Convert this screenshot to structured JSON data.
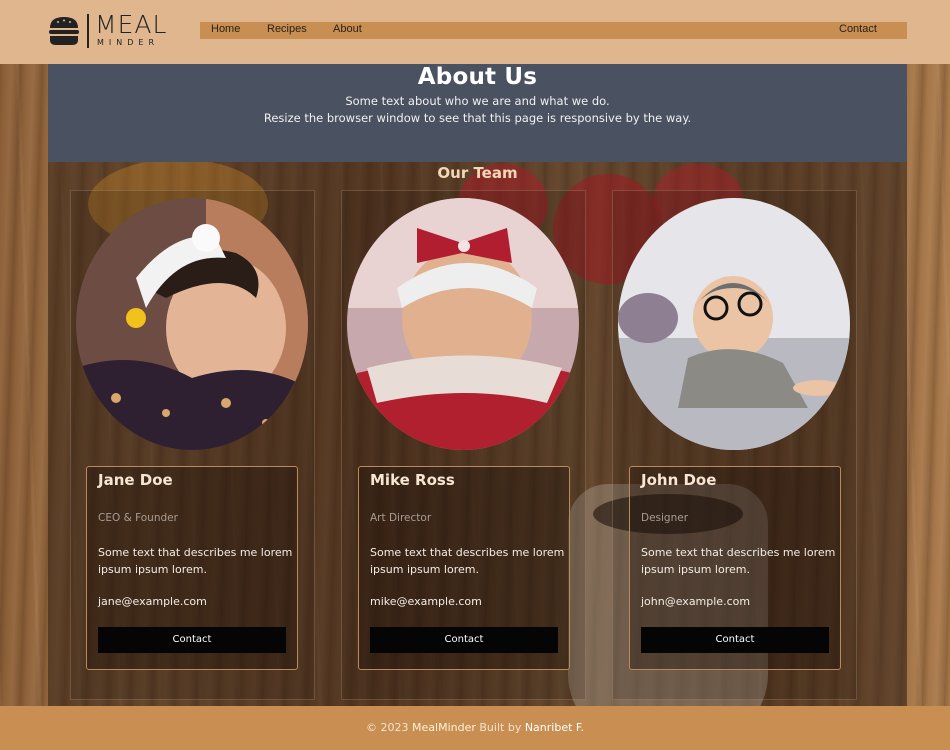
{
  "header": {
    "logo_main": "MEAL",
    "logo_sub": "MINDER",
    "nav": {
      "home": "Home",
      "recipes": "Recipes",
      "about": "About",
      "contact": "Contact"
    },
    "colors": {
      "header_bg": "#e0b68e",
      "navbar_bg": "#c98e52"
    }
  },
  "about": {
    "title": "About Us",
    "line1": "Some text about who we are and what we do.",
    "line2": "Resize the browser window to see that this page is responsive by the way."
  },
  "team": {
    "title": "Our Team",
    "members": [
      {
        "name": "Jane Doe",
        "role": "CEO & Founder",
        "desc": "Some text that describes me lorem ipsum ipsum lorem.",
        "email": "jane@example.com",
        "button": "Contact"
      },
      {
        "name": "Mike Ross",
        "role": "Art Director",
        "desc": "Some text that describes me lorem ipsum ipsum lorem.",
        "email": "mike@example.com",
        "button": "Contact"
      },
      {
        "name": "John Doe",
        "role": "Designer",
        "desc": "Some text that describes me lorem ipsum ipsum lorem.",
        "email": "john@example.com",
        "button": "Contact"
      }
    ]
  },
  "footer": {
    "prefix": "© 2023",
    "brand": "MealMinder",
    "built_by": "Built by",
    "author": "Nanribet F."
  }
}
